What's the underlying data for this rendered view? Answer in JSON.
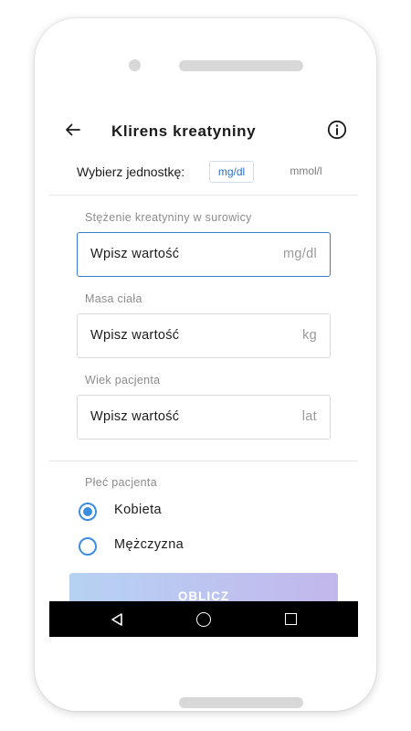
{
  "app": {
    "title": "Klirens kreatyniny"
  },
  "icons": {
    "back": "arrow-left-icon",
    "info": "info-circle-icon"
  },
  "units": {
    "label": "Wybierz jednostkę:",
    "options": [
      "mg/dl",
      "mmol/l"
    ],
    "selected": "mg/dl",
    "accent_color": "#2b6fc5"
  },
  "fields": [
    {
      "label": "Stężenie kreatyniny w surowicy",
      "placeholder": "Wpisz wartość",
      "unit": "mg/dl",
      "active": true
    },
    {
      "label": "Masa ciała",
      "placeholder": "Wpisz wartość",
      "unit": "kg"
    },
    {
      "label": "Wiek pacjenta",
      "placeholder": "Wpisz wartość",
      "unit": "lat"
    }
  ],
  "gender": {
    "label": "Płeć pacjenta",
    "options": [
      "Kobieta",
      "Mężczyzna"
    ],
    "selected": "Kobieta",
    "radio_color": "#3d8ee0"
  },
  "calculate": {
    "label": "OBLICZ",
    "gradient_colors": [
      "#b6d2f3",
      "#c2b7ec"
    ]
  },
  "system_nav": {
    "icons": [
      "nav-back-icon",
      "nav-home-icon",
      "nav-recents-icon"
    ]
  }
}
